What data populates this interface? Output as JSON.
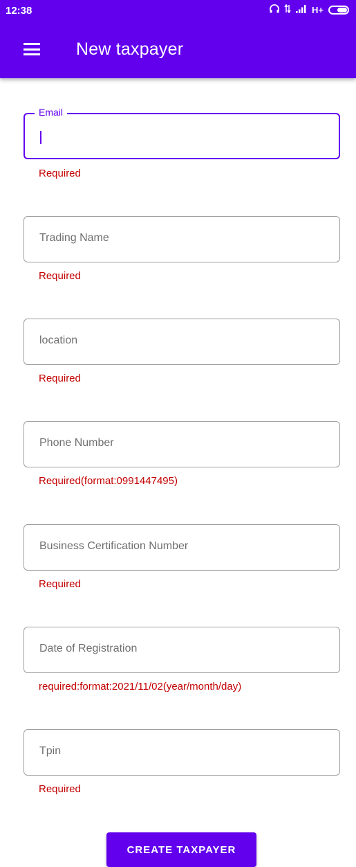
{
  "status_bar": {
    "time": "12:38",
    "icons": [
      "headphones-icon",
      "data-arrows-icon",
      "signal-icon",
      "network-type-icon",
      "battery-icon"
    ],
    "network_type": "H+"
  },
  "app_bar": {
    "title": "New taxpayer",
    "menu_icon": "menu-icon"
  },
  "form": {
    "fields": [
      {
        "label": "Email",
        "value": "",
        "focused": true,
        "helper": "Required"
      },
      {
        "label": "Trading Name",
        "value": "",
        "focused": false,
        "helper": "Required"
      },
      {
        "label": "location",
        "value": "",
        "focused": false,
        "helper": "Required"
      },
      {
        "label": "Phone Number",
        "value": "",
        "focused": false,
        "helper": "Required(format:0991447495)"
      },
      {
        "label": "Business Certification Number",
        "value": "",
        "focused": false,
        "helper": "Required"
      },
      {
        "label": "Date of Registration",
        "value": "",
        "focused": false,
        "helper": "required:format:2021/11/02(year/month/day)"
      },
      {
        "label": "Tpin",
        "value": "",
        "focused": false,
        "helper": "Required"
      }
    ],
    "submit_label": "CREATE TAXPAYER"
  },
  "colors": {
    "primary": "#6200ee",
    "error": "#c30000",
    "outline": "#9e9e9e",
    "label": "#6f6f6f"
  }
}
